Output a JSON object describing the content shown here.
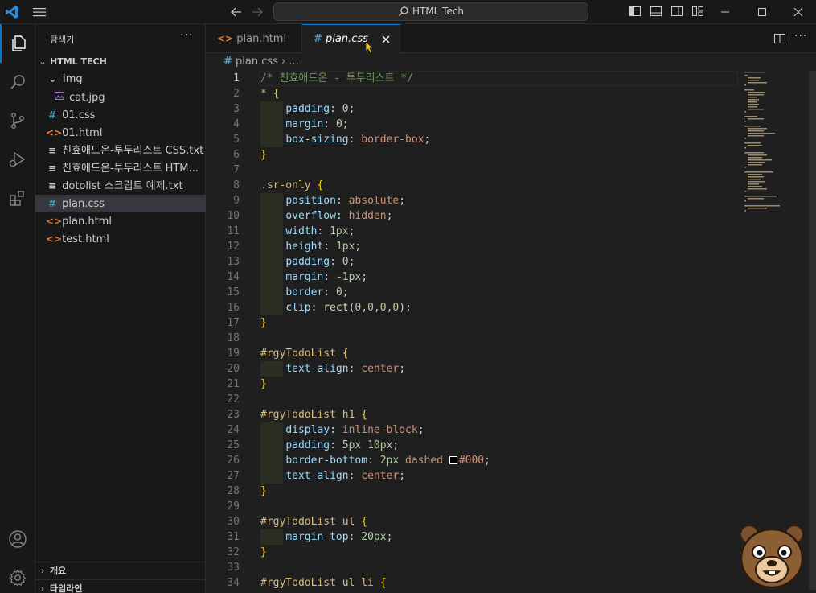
{
  "titlebar": {
    "search_text": "HTML Tech"
  },
  "sidebar": {
    "title": "탐색기",
    "more": "···",
    "root": "HTML TECH",
    "items": [
      {
        "label": "img",
        "type": "folder"
      },
      {
        "label": "cat.jpg",
        "type": "image"
      },
      {
        "label": "01.css",
        "type": "css"
      },
      {
        "label": "01.html",
        "type": "html"
      },
      {
        "label": "친효애드온-투두리스트 CSS.txt",
        "type": "txt"
      },
      {
        "label": "친효애드온-투두리스트 HTM...",
        "type": "txt"
      },
      {
        "label": "dotolist 스크립트 예제.txt",
        "type": "txt"
      },
      {
        "label": "plan.css",
        "type": "css"
      },
      {
        "label": "plan.html",
        "type": "html"
      },
      {
        "label": "test.html",
        "type": "html"
      }
    ],
    "outline": "개요",
    "timeline": "타임라인"
  },
  "tabs": [
    {
      "label": "plan.html",
      "type": "html"
    },
    {
      "label": "plan.css",
      "type": "css"
    }
  ],
  "breadcrumb": {
    "file": "plan.css",
    "rest": "..."
  },
  "editor": {
    "current_line": 1,
    "lines": [
      [
        {
          "c": "t-comment",
          "t": "/* 친효애드온 - 투두리스트 */"
        }
      ],
      [
        {
          "c": "t-sel",
          "t": "* "
        },
        {
          "c": "t-brace",
          "t": "{"
        }
      ],
      [
        {
          "c": "",
          "t": "    "
        },
        {
          "c": "t-prop",
          "t": "padding"
        },
        {
          "c": "t-punc",
          "t": ": "
        },
        {
          "c": "t-num",
          "t": "0"
        },
        {
          "c": "t-punc",
          "t": ";"
        }
      ],
      [
        {
          "c": "",
          "t": "    "
        },
        {
          "c": "t-prop",
          "t": "margin"
        },
        {
          "c": "t-punc",
          "t": ": "
        },
        {
          "c": "t-num",
          "t": "0"
        },
        {
          "c": "t-punc",
          "t": ";"
        }
      ],
      [
        {
          "c": "",
          "t": "    "
        },
        {
          "c": "t-prop",
          "t": "box-sizing"
        },
        {
          "c": "t-punc",
          "t": ": "
        },
        {
          "c": "t-val",
          "t": "border-box"
        },
        {
          "c": "t-punc",
          "t": ";"
        }
      ],
      [
        {
          "c": "t-brace",
          "t": "}"
        }
      ],
      [],
      [
        {
          "c": "t-sel",
          "t": ".sr-only "
        },
        {
          "c": "t-brace",
          "t": "{"
        }
      ],
      [
        {
          "c": "",
          "t": "    "
        },
        {
          "c": "t-prop",
          "t": "position"
        },
        {
          "c": "t-punc",
          "t": ": "
        },
        {
          "c": "t-val",
          "t": "absolute"
        },
        {
          "c": "t-punc",
          "t": ";"
        }
      ],
      [
        {
          "c": "",
          "t": "    "
        },
        {
          "c": "t-prop",
          "t": "overflow"
        },
        {
          "c": "t-punc",
          "t": ": "
        },
        {
          "c": "t-val",
          "t": "hidden"
        },
        {
          "c": "t-punc",
          "t": ";"
        }
      ],
      [
        {
          "c": "",
          "t": "    "
        },
        {
          "c": "t-prop",
          "t": "width"
        },
        {
          "c": "t-punc",
          "t": ": "
        },
        {
          "c": "t-num",
          "t": "1px"
        },
        {
          "c": "t-punc",
          "t": ";"
        }
      ],
      [
        {
          "c": "",
          "t": "    "
        },
        {
          "c": "t-prop",
          "t": "height"
        },
        {
          "c": "t-punc",
          "t": ": "
        },
        {
          "c": "t-num",
          "t": "1px"
        },
        {
          "c": "t-punc",
          "t": ";"
        }
      ],
      [
        {
          "c": "",
          "t": "    "
        },
        {
          "c": "t-prop",
          "t": "padding"
        },
        {
          "c": "t-punc",
          "t": ": "
        },
        {
          "c": "t-num",
          "t": "0"
        },
        {
          "c": "t-punc",
          "t": ";"
        }
      ],
      [
        {
          "c": "",
          "t": "    "
        },
        {
          "c": "t-prop",
          "t": "margin"
        },
        {
          "c": "t-punc",
          "t": ": "
        },
        {
          "c": "t-num",
          "t": "-1px"
        },
        {
          "c": "t-punc",
          "t": ";"
        }
      ],
      [
        {
          "c": "",
          "t": "    "
        },
        {
          "c": "t-prop",
          "t": "border"
        },
        {
          "c": "t-punc",
          "t": ": "
        },
        {
          "c": "t-num",
          "t": "0"
        },
        {
          "c": "t-punc",
          "t": ";"
        }
      ],
      [
        {
          "c": "",
          "t": "    "
        },
        {
          "c": "t-prop",
          "t": "clip"
        },
        {
          "c": "t-punc",
          "t": ": "
        },
        {
          "c": "t-fn",
          "t": "rect"
        },
        {
          "c": "t-punc",
          "t": "("
        },
        {
          "c": "t-num",
          "t": "0"
        },
        {
          "c": "t-punc",
          "t": ","
        },
        {
          "c": "t-num",
          "t": "0"
        },
        {
          "c": "t-punc",
          "t": ","
        },
        {
          "c": "t-num",
          "t": "0"
        },
        {
          "c": "t-punc",
          "t": ","
        },
        {
          "c": "t-num",
          "t": "0"
        },
        {
          "c": "t-punc",
          "t": ");"
        }
      ],
      [
        {
          "c": "t-brace",
          "t": "}"
        }
      ],
      [],
      [
        {
          "c": "t-sel",
          "t": "#rgyTodoList "
        },
        {
          "c": "t-brace",
          "t": "{"
        }
      ],
      [
        {
          "c": "",
          "t": "    "
        },
        {
          "c": "t-prop",
          "t": "text-align"
        },
        {
          "c": "t-punc",
          "t": ": "
        },
        {
          "c": "t-val",
          "t": "center"
        },
        {
          "c": "t-punc",
          "t": ";"
        }
      ],
      [
        {
          "c": "t-brace",
          "t": "}"
        }
      ],
      [],
      [
        {
          "c": "t-sel",
          "t": "#rgyTodoList h1 "
        },
        {
          "c": "t-brace",
          "t": "{"
        }
      ],
      [
        {
          "c": "",
          "t": "    "
        },
        {
          "c": "t-prop",
          "t": "display"
        },
        {
          "c": "t-punc",
          "t": ": "
        },
        {
          "c": "t-val",
          "t": "inline-block"
        },
        {
          "c": "t-punc",
          "t": ";"
        }
      ],
      [
        {
          "c": "",
          "t": "    "
        },
        {
          "c": "t-prop",
          "t": "padding"
        },
        {
          "c": "t-punc",
          "t": ": "
        },
        {
          "c": "t-num",
          "t": "5px 10px"
        },
        {
          "c": "t-punc",
          "t": ";"
        }
      ],
      [
        {
          "c": "",
          "t": "    "
        },
        {
          "c": "t-prop",
          "t": "border-bottom"
        },
        {
          "c": "t-punc",
          "t": ": "
        },
        {
          "c": "t-num",
          "t": "2px "
        },
        {
          "c": "t-val",
          "t": "dashed "
        },
        {
          "c": "swatch",
          "t": ""
        },
        {
          "c": "t-val",
          "t": "#000"
        },
        {
          "c": "t-punc",
          "t": ";"
        }
      ],
      [
        {
          "c": "",
          "t": "    "
        },
        {
          "c": "t-prop",
          "t": "text-align"
        },
        {
          "c": "t-punc",
          "t": ": "
        },
        {
          "c": "t-val",
          "t": "center"
        },
        {
          "c": "t-punc",
          "t": ";"
        }
      ],
      [
        {
          "c": "t-brace",
          "t": "}"
        }
      ],
      [],
      [
        {
          "c": "t-sel",
          "t": "#rgyTodoList ul "
        },
        {
          "c": "t-brace",
          "t": "{"
        }
      ],
      [
        {
          "c": "",
          "t": "    "
        },
        {
          "c": "t-prop",
          "t": "margin-top"
        },
        {
          "c": "t-punc",
          "t": ": "
        },
        {
          "c": "t-num",
          "t": "20px"
        },
        {
          "c": "t-punc",
          "t": ";"
        }
      ],
      [
        {
          "c": "t-brace",
          "t": "}"
        }
      ],
      [],
      [
        {
          "c": "t-sel",
          "t": "#rgyTodoList ul li "
        },
        {
          "c": "t-brace",
          "t": "{"
        }
      ]
    ]
  }
}
